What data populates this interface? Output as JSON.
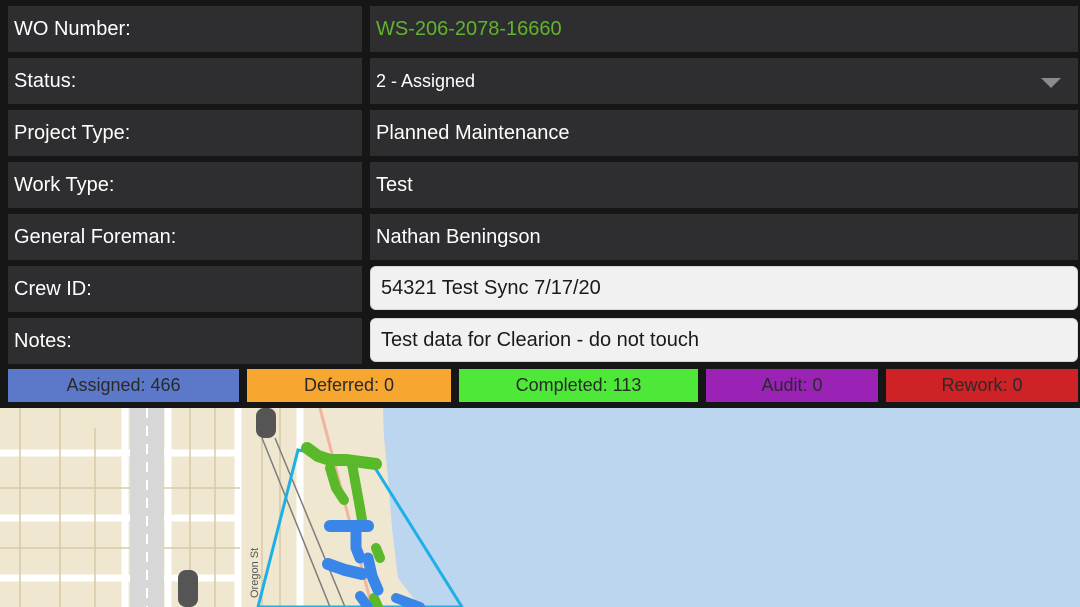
{
  "form": {
    "wo_number": {
      "label": "WO Number:",
      "value": "WS-206-2078-16660"
    },
    "status": {
      "label": "Status:",
      "value": "2 - Assigned"
    },
    "project_type": {
      "label": "Project Type:",
      "value": "Planned Maintenance"
    },
    "work_type": {
      "label": "Work Type:",
      "value": "Test"
    },
    "general_foreman": {
      "label": "General Foreman:",
      "value": "Nathan Beningson"
    },
    "crew_id": {
      "label": "Crew ID:",
      "value": "54321 Test Sync 7/17/20"
    },
    "notes": {
      "label": "Notes:",
      "value": "Test data for Clearion - do not touch"
    }
  },
  "status_counts": [
    {
      "label": "Assigned: 466",
      "color": "#5b78c9"
    },
    {
      "label": "Deferred: 0",
      "color": "#f7a630"
    },
    {
      "label": "Completed: 113",
      "color": "#4ee838"
    },
    {
      "label": "Audit: 0",
      "color": "#9a22b4"
    },
    {
      "label": "Rework: 0",
      "color": "#cf2226"
    }
  ],
  "map": {
    "street_label": "Oregon St",
    "colors": {
      "land": "#efe7cf",
      "water": "#bcd6ef",
      "boundary": "#1cb0e6",
      "completed": "#5ab82b",
      "assigned": "#3a86e8"
    }
  }
}
